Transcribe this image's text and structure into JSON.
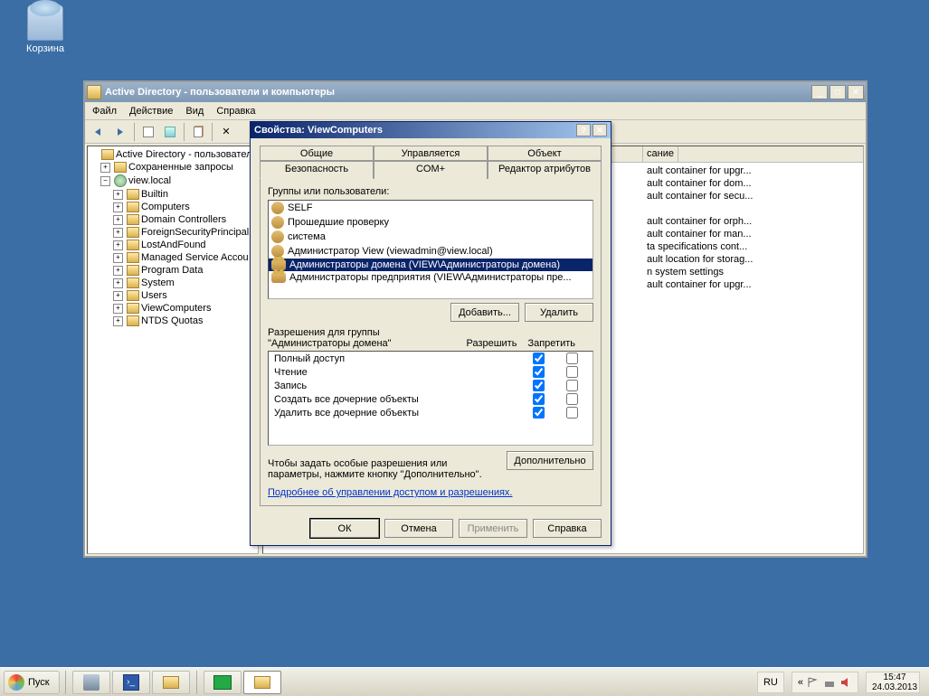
{
  "desktop": {
    "recycle_bin": "Корзина"
  },
  "window": {
    "title": "Active Directory - пользователи и компьютеры",
    "menu": [
      "Файл",
      "Действие",
      "Вид",
      "Справка"
    ]
  },
  "tree": {
    "root": "Active Directory - пользовател",
    "saved": "Сохраненные запросы",
    "domain": "view.local",
    "items": [
      "Builtin",
      "Computers",
      "Domain Controllers",
      "ForeignSecurityPrincipal",
      "LostAndFound",
      "Managed Service Accou",
      "Program Data",
      "System",
      "Users",
      "ViewComputers",
      "NTDS Quotas"
    ]
  },
  "list": {
    "header_desc": "сание",
    "rows": [
      "ault container for upgr...",
      "ault container for dom...",
      "ault container for secu...",
      "",
      "ault container for orph...",
      "ault container for man...",
      "ta specifications cont...",
      "ault location for storag...",
      "n system settings",
      "ault container for upgr..."
    ]
  },
  "dialog": {
    "title": "Свойства: ViewComputers",
    "tabs_row1": [
      "Общие",
      "Управляется",
      "Объект"
    ],
    "tabs_row2": [
      "Безопасность",
      "COM+",
      "Редактор атрибутов"
    ],
    "groups_label": "Группы или пользователи:",
    "groups": [
      "SELF",
      "Прошедшие проверку",
      "система",
      "Администратор View (viewadmin@view.local)",
      "Администраторы домена (VIEW\\Администраторы домена)",
      "Администраторы предприятия (VIEW\\Администраторы пре..."
    ],
    "add_btn": "Добавить...",
    "remove_btn": "Удалить",
    "perm_label": "Разрешения для группы \"Администраторы домена\"",
    "perm_allow": "Разрешить",
    "perm_deny": "Запретить",
    "perms": [
      {
        "label": "Полный доступ",
        "allow": true,
        "deny": false
      },
      {
        "label": "Чтение",
        "allow": true,
        "deny": false
      },
      {
        "label": "Запись",
        "allow": true,
        "deny": false
      },
      {
        "label": "Создать все дочерние объекты",
        "allow": true,
        "deny": false
      },
      {
        "label": "Удалить все дочерние объекты",
        "allow": true,
        "deny": false
      }
    ],
    "hint": "Чтобы задать особые разрешения или параметры, нажмите кнопку \"Дополнительно\".",
    "adv_btn": "Дополнительно",
    "link": "Подробнее об управлении доступом и разрешениях.",
    "ok": "ОК",
    "cancel": "Отмена",
    "apply": "Применить",
    "help": "Справка"
  },
  "taskbar": {
    "start": "Пуск",
    "lang": "RU",
    "time": "15:47",
    "date": "24.03.2013"
  }
}
